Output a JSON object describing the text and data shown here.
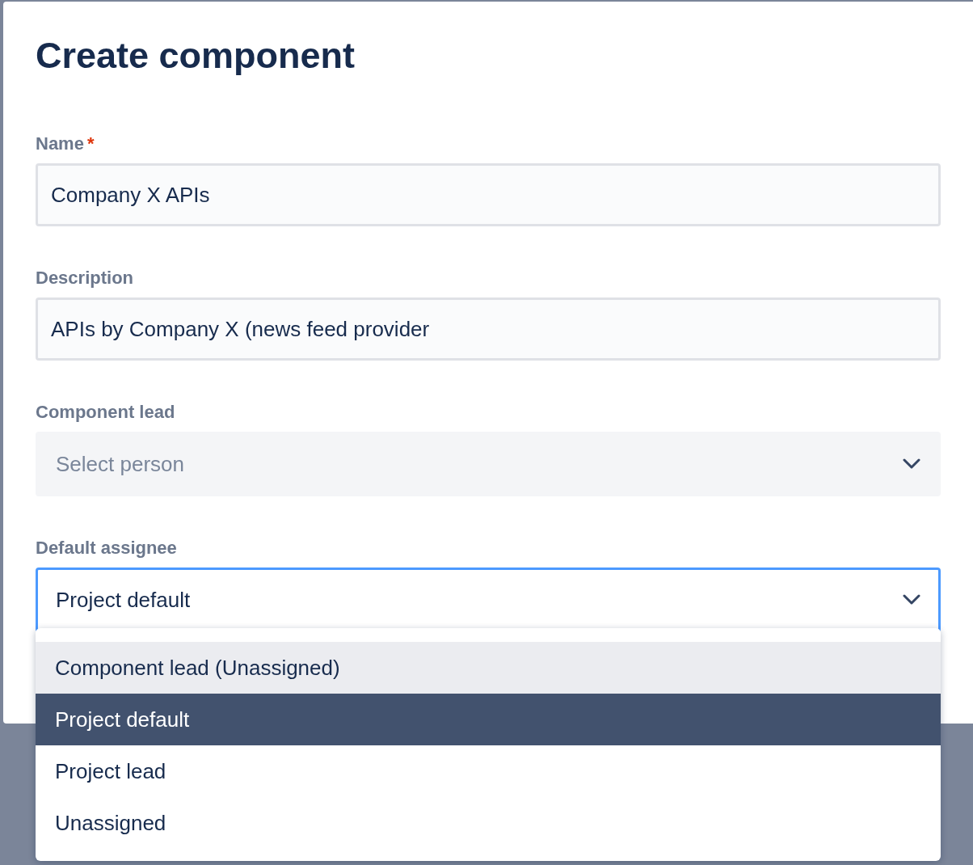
{
  "dialog": {
    "title": "Create component",
    "fields": [
      {
        "kind": "text",
        "label": "Name",
        "required_mark": "*",
        "value": "Company X APIs",
        "focused": false
      },
      {
        "kind": "text",
        "label": "Description",
        "value": "APIs by Company X (news feed provider",
        "focused": false
      },
      {
        "kind": "select",
        "label": "Component lead",
        "placeholder": "Select person",
        "focused": false
      },
      {
        "kind": "select",
        "label": "Default assignee",
        "value": "Project default",
        "focused": true
      }
    ]
  },
  "dropdown_menu": {
    "options": [
      {
        "label": "Component lead (Unassigned)",
        "selected": false,
        "highlighted": true
      },
      {
        "label": "Project default",
        "selected": true,
        "highlighted": false
      },
      {
        "label": "Project lead",
        "selected": false,
        "highlighted": false
      },
      {
        "label": "Unassigned",
        "selected": false,
        "highlighted": false
      }
    ]
  }
}
